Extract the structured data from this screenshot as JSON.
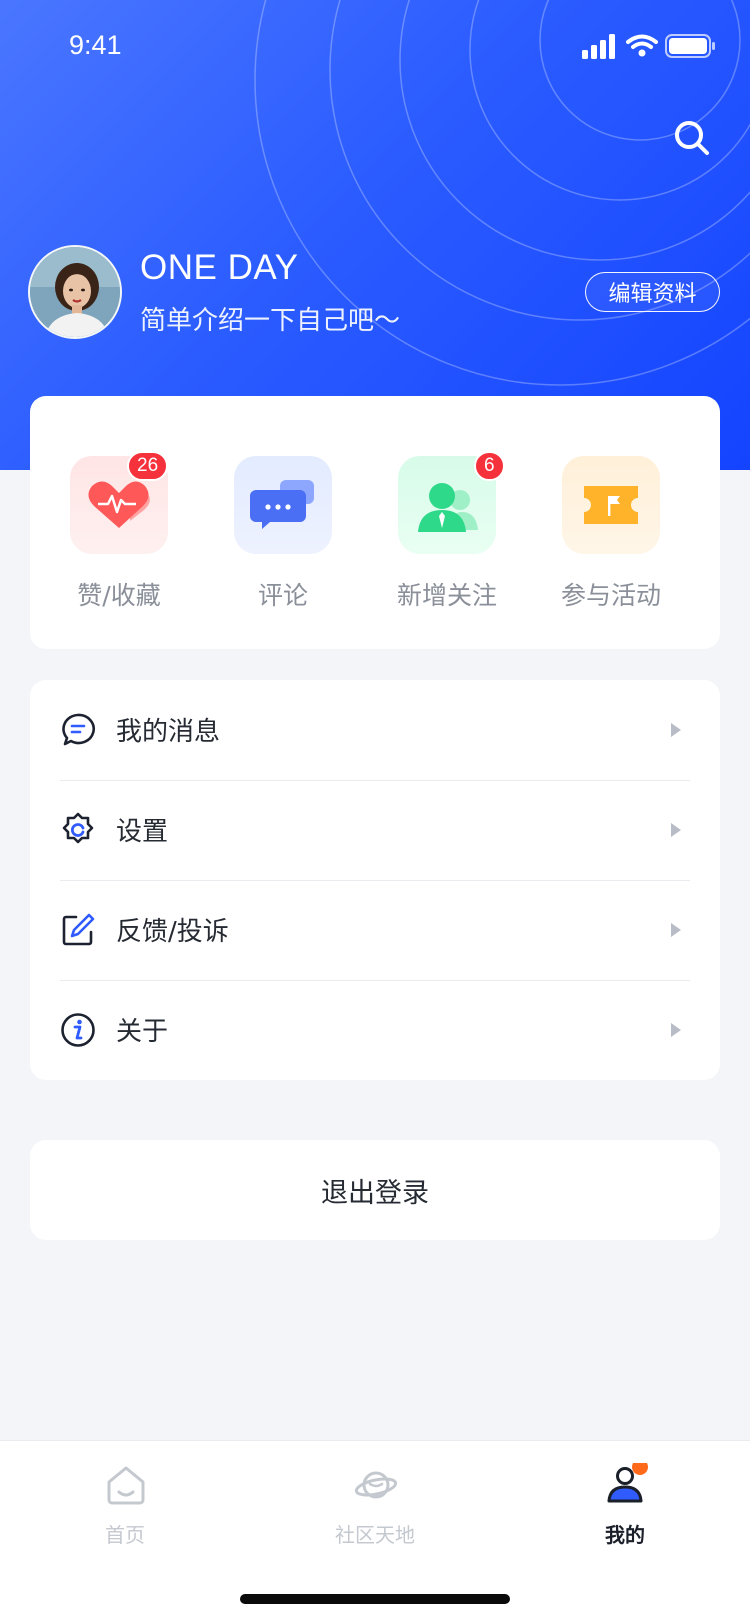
{
  "status_bar": {
    "time": "9:41"
  },
  "profile": {
    "name": "ONE DAY",
    "bio": "简单介绍一下自己吧～",
    "edit_label": "编辑资料"
  },
  "stats": [
    {
      "label": "赞/收藏",
      "badge": "26",
      "icon": "heart-pulse-icon"
    },
    {
      "label": "评论",
      "badge": "",
      "icon": "chat-bubble-icon"
    },
    {
      "label": "新增关注",
      "badge": "6",
      "icon": "person-icon"
    },
    {
      "label": "参与活动",
      "badge": "",
      "icon": "ticket-flag-icon"
    }
  ],
  "menu": [
    {
      "label": "我的消息",
      "icon": "message-icon"
    },
    {
      "label": "设置",
      "icon": "gear-icon"
    },
    {
      "label": "反馈/投诉",
      "icon": "edit-icon"
    },
    {
      "label": "关于",
      "icon": "info-icon"
    }
  ],
  "logout_label": "退出登录",
  "tabs": [
    {
      "label": "首页",
      "icon": "home-icon",
      "active": false
    },
    {
      "label": "社区天地",
      "icon": "planet-icon",
      "active": false
    },
    {
      "label": "我的",
      "icon": "user-icon",
      "active": true
    }
  ],
  "colors": {
    "header_blue": "#2b5cff",
    "badge_red": "#f5313c",
    "accent_orange": "#ff6a1a"
  }
}
